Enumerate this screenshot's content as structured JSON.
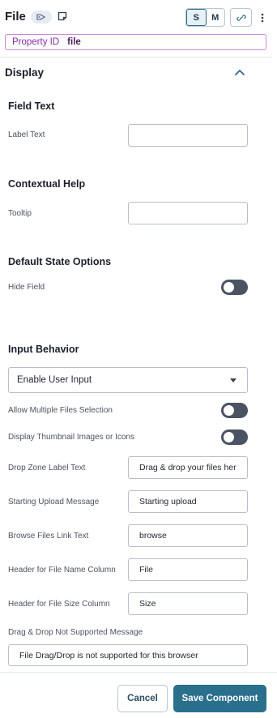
{
  "header": {
    "title": "File",
    "size_options": [
      "S",
      "M"
    ],
    "active_size": "S"
  },
  "property": {
    "label": "Property ID",
    "value": "file"
  },
  "display_section": {
    "title": "Display"
  },
  "field_text": {
    "title": "Field Text",
    "label_text": {
      "label": "Label Text",
      "value": ""
    }
  },
  "contextual_help": {
    "title": "Contextual Help",
    "tooltip": {
      "label": "Tooltip",
      "value": ""
    }
  },
  "default_state": {
    "title": "Default State Options",
    "hide_field": {
      "label": "Hide Field",
      "on": false
    }
  },
  "input_behavior": {
    "title": "Input Behavior",
    "mode": {
      "selected": "Enable User Input"
    },
    "allow_multiple": {
      "label": "Allow Multiple Files Selection",
      "on": false
    },
    "display_thumbnails": {
      "label": "Display Thumbnail Images or Icons",
      "on": false
    },
    "drop_zone_label": {
      "label": "Drop Zone Label Text",
      "value": "Drag & drop your files her"
    },
    "starting_upload": {
      "label": "Starting Upload Message",
      "value": "Starting upload"
    },
    "browse_link": {
      "label": "Browse Files Link Text",
      "value": "browse"
    },
    "file_name_column": {
      "label": "Header for File Name Column",
      "value": "File"
    },
    "file_size_column": {
      "label": "Header for File Size Column",
      "value": "Size"
    },
    "dnd_not_supported": {
      "label": "Drag & Drop Not Supported Message",
      "value": "File Drag/Drop is not supported for this browser"
    }
  },
  "footer": {
    "cancel_label": "Cancel",
    "save_label": "Save Component"
  },
  "colors": {
    "accent": "#2a6f8c",
    "toggle_off": "#4a5361",
    "property_border": "#c98bd6"
  }
}
